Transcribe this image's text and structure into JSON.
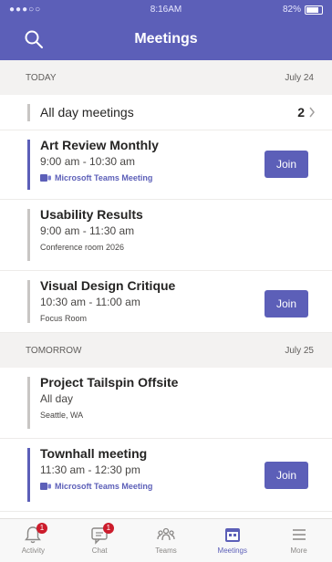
{
  "status": {
    "signal": "●●●○○",
    "time": "8:16AM",
    "battery": "82%"
  },
  "header": {
    "title": "Meetings"
  },
  "today": {
    "label": "TODAY",
    "date": "July 24",
    "all_day": {
      "label": "All day meetings",
      "count": "2"
    },
    "meetings": [
      {
        "title": "Art Review Monthly",
        "time": "9:00 am - 10:30 am",
        "location": "Microsoft Teams Meeting",
        "join": "Join"
      },
      {
        "title": "Usability Results",
        "time": "9:00 am - 11:30 am",
        "location": "Conference room 2026"
      },
      {
        "title": "Visual Design Critique",
        "time": "10:30 am - 11:00 am",
        "location": "Focus Room",
        "join": "Join"
      }
    ]
  },
  "tomorrow": {
    "label": "TOMORROW",
    "date": "July 25",
    "meetings": [
      {
        "title": "Project Tailspin Offsite",
        "time": "All day",
        "location": "Seattle, WA"
      },
      {
        "title": "Townhall meeting",
        "time": "11:30 am - 12:30 pm",
        "location": "Microsoft Teams Meeting",
        "join": "Join"
      }
    ]
  },
  "tabs": [
    {
      "label": "Activity",
      "icon": "bell-icon",
      "badge": "1"
    },
    {
      "label": "Chat",
      "icon": "chat-icon",
      "badge": "1"
    },
    {
      "label": "Teams",
      "icon": "teams-icon"
    },
    {
      "label": "Meetings",
      "icon": "calendar-icon",
      "active": true
    },
    {
      "label": "More",
      "icon": "menu-icon"
    }
  ],
  "colors": {
    "brand": "#5c5fb8",
    "badge": "#cc1c2c",
    "section_bg": "#f3f2f1"
  }
}
